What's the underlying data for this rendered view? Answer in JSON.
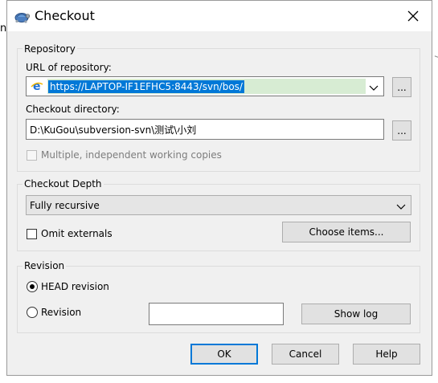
{
  "background": {
    "left_fragment": "n"
  },
  "dialog": {
    "title": "Checkout",
    "colors": {
      "accent": "#0078d7",
      "url_highlight": "#d7ecd3"
    }
  },
  "repository": {
    "group_label": "Repository",
    "url_label": "URL of repository:",
    "url_value": "https://LAPTOP-IF1EFHC5:8443/svn/bos/",
    "url_browse_label": "...",
    "dir_label": "Checkout directory:",
    "dir_value": "D:\\KuGou\\subversion-svn\\测试\\小刘",
    "dir_browse_label": "...",
    "multiple_label": "Multiple, independent working copies"
  },
  "depth": {
    "group_label": "Checkout Depth",
    "selected": "Fully recursive",
    "omit_externals_label": "Omit externals",
    "choose_items_label": "Choose items..."
  },
  "revision": {
    "group_label": "Revision",
    "head_label": "HEAD revision",
    "revision_label": "Revision",
    "revision_value": "",
    "show_log_label": "Show log"
  },
  "footer": {
    "ok_label": "OK",
    "cancel_label": "Cancel",
    "help_label": "Help"
  }
}
